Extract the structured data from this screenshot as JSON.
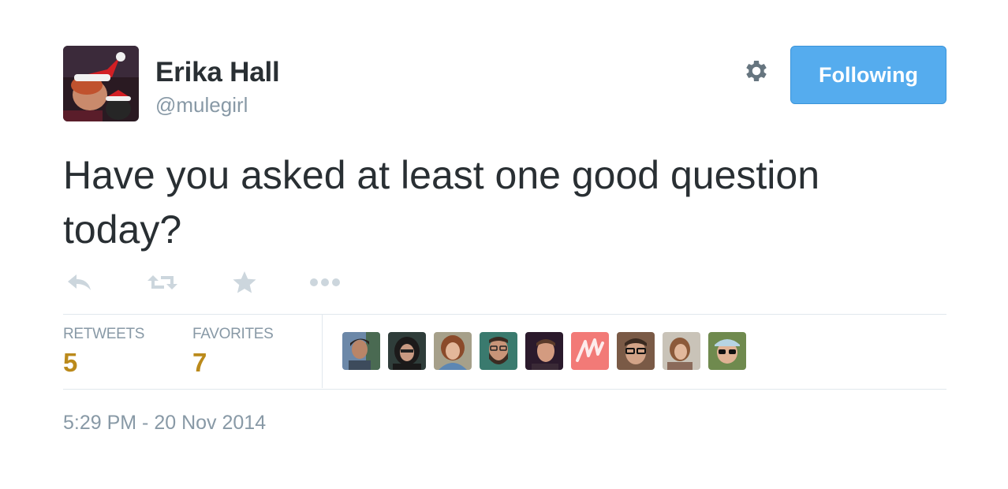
{
  "author": {
    "name": "Erika Hall",
    "handle": "@mulegirl",
    "avatar_icon": "user-avatar"
  },
  "header": {
    "settings_icon": "gear-icon",
    "follow_label": "Following"
  },
  "tweet": {
    "text": "Have you asked at least one good question today?"
  },
  "actions": [
    {
      "name": "reply",
      "icon": "reply-icon"
    },
    {
      "name": "retweet",
      "icon": "retweet-icon"
    },
    {
      "name": "favorite",
      "icon": "star-icon"
    },
    {
      "name": "more",
      "icon": "more-icon"
    }
  ],
  "stats": {
    "retweets_label": "RETWEETS",
    "retweets_count": "5",
    "favorites_label": "FAVORITES",
    "favorites_count": "7"
  },
  "favorited_by_count": 9,
  "timestamp": "5:29 PM - 20 Nov 2014",
  "colors": {
    "accent": "#55acee",
    "stat_value": "#bb8a1b",
    "muted": "#8899a6",
    "action_icon": "#ccd6dd",
    "text": "#292f33"
  }
}
